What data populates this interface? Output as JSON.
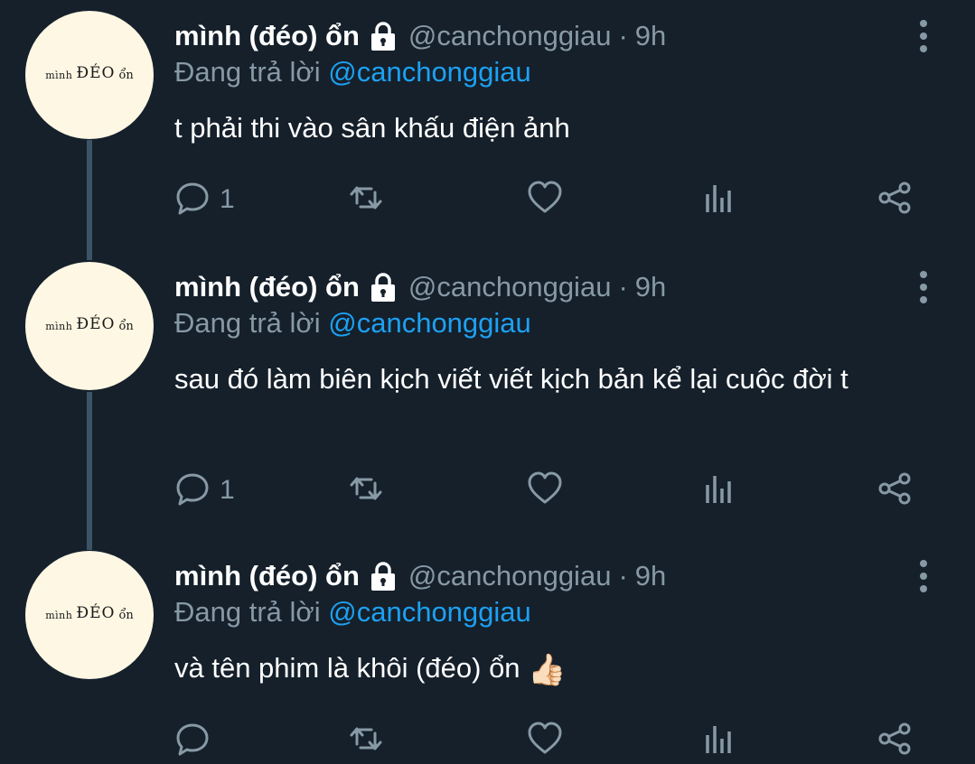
{
  "tweets": [
    {
      "avatar": {
        "a1": "mình",
        "a2": "ĐÉO",
        "a3": "ổn"
      },
      "name": "mình (đéo) ổn",
      "handle": "@canchonggiau",
      "separator": "·",
      "time": "9h",
      "replying_label": "Đang trả lời",
      "replying_to": "@canchonggiau",
      "text": "t phải thi vào sân khấu điện ảnh",
      "emoji": "",
      "reply_count": "1"
    },
    {
      "avatar": {
        "a1": "mình",
        "a2": "ĐÉO",
        "a3": "ổn"
      },
      "name": "mình (đéo) ổn",
      "handle": "@canchonggiau",
      "separator": "·",
      "time": "9h",
      "replying_label": "Đang trả lời",
      "replying_to": "@canchonggiau",
      "text": "sau đó làm biên kịch viết viết kịch bản kể lại cuộc đời t",
      "emoji": "",
      "reply_count": "1"
    },
    {
      "avatar": {
        "a1": "mình",
        "a2": "ĐÉO",
        "a3": "ổn"
      },
      "name": "mình (đéo) ổn",
      "handle": "@canchonggiau",
      "separator": "·",
      "time": "9h",
      "replying_label": "Đang trả lời",
      "replying_to": "@canchonggiau",
      "text": "và tên phim là khôi (đéo) ổn",
      "emoji": "👍🏻",
      "reply_count": ""
    }
  ],
  "icons": {
    "lock": "lock-icon",
    "reply": "reply-icon",
    "retweet": "retweet-icon",
    "like": "heart-icon",
    "analytics": "analytics-icon",
    "share": "share-icon",
    "more": "more-vertical-icon"
  },
  "colors": {
    "background": "#15202b",
    "secondary_text": "#8899a6",
    "mention": "#1da1f2",
    "thread_line": "#3d5466",
    "avatar_bg": "#fdf7e3"
  }
}
